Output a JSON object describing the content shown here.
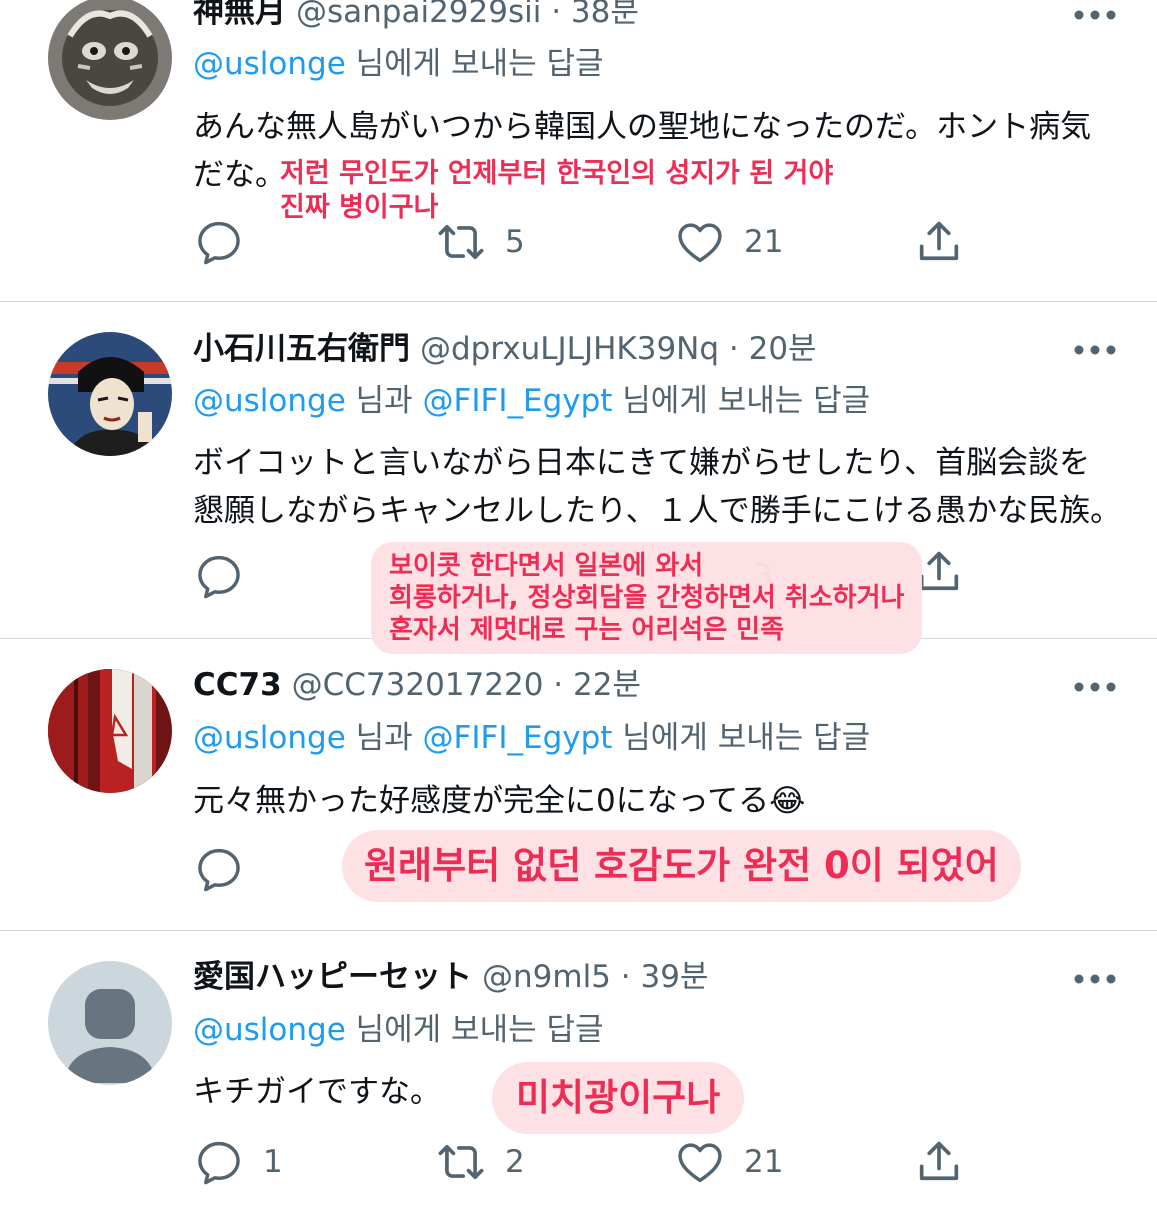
{
  "tweets": [
    {
      "name": "神無月",
      "meta": "@sanpai2929sii · 38분",
      "reply_to": {
        "mentions": [
          "@uslonge"
        ],
        "connector": "",
        "suffix": " 님에게 보내는 답글"
      },
      "text_line1": "あんな無人島がいつから韓国人の聖地になったのだ。ホント病気",
      "text_line2": "だな。",
      "translation": [
        "저런 무인도가 언제부터 한국인의 성지가 된 거야",
        "진짜 병이구나"
      ],
      "actions": {
        "reply": "",
        "retweet": "5",
        "like": "21"
      }
    },
    {
      "name": "小石川五右衛門",
      "meta": "@dprxuLJLJHK39Nq · 20분",
      "reply_to": {
        "mentions": [
          "@uslonge",
          "@FIFI_Egypt"
        ],
        "connector": " 님과 ",
        "suffix": " 님에게 보내는 답글"
      },
      "text_line1": "ボイコットと言いながら日本にきて嫌がらせしたり、首脳会談を",
      "text_line2": "懇願しながらキャンセルしたり、１人で勝手にこける愚かな民族。",
      "translation": [
        "보이콧 한다면서 일본에 와서",
        "희롱하거나, 정상회담을 간청하면서 취소하거나",
        "혼자서 제멋대로 구는 어리석은 민족"
      ],
      "actions": {
        "like_partial": "3"
      }
    },
    {
      "name": "CC73",
      "meta": "@CC732017220 · 22분",
      "reply_to": {
        "mentions": [
          "@uslonge",
          "@FIFI_Egypt"
        ],
        "connector": " 님과 ",
        "suffix": " 님에게 보내는 답글"
      },
      "text_line1": "元々無かった好感度が完全に0になってる",
      "emoji": "😂",
      "translation": [
        "원래부터 없던 호감도가 완전 0이 되었어"
      ],
      "actions": {}
    },
    {
      "name": "愛国ハッピーセット",
      "meta": "@n9ml5 · 39분",
      "reply_to": {
        "mentions": [
          "@uslonge"
        ],
        "connector": "",
        "suffix": " 님에게 보내는 답글"
      },
      "text_line1": "キチガイですな。",
      "translation": [
        "미치광이구나"
      ],
      "actions": {
        "reply": "1",
        "retweet": "2",
        "like": "21"
      }
    }
  ],
  "colors": {
    "accent": "#1d9bf0",
    "secondary_text": "#536471",
    "annotation": "#ee2d55",
    "divider": "#cfd9de"
  },
  "icons": [
    "reply-icon",
    "retweet-icon",
    "like-icon",
    "share-icon",
    "more-icon"
  ]
}
